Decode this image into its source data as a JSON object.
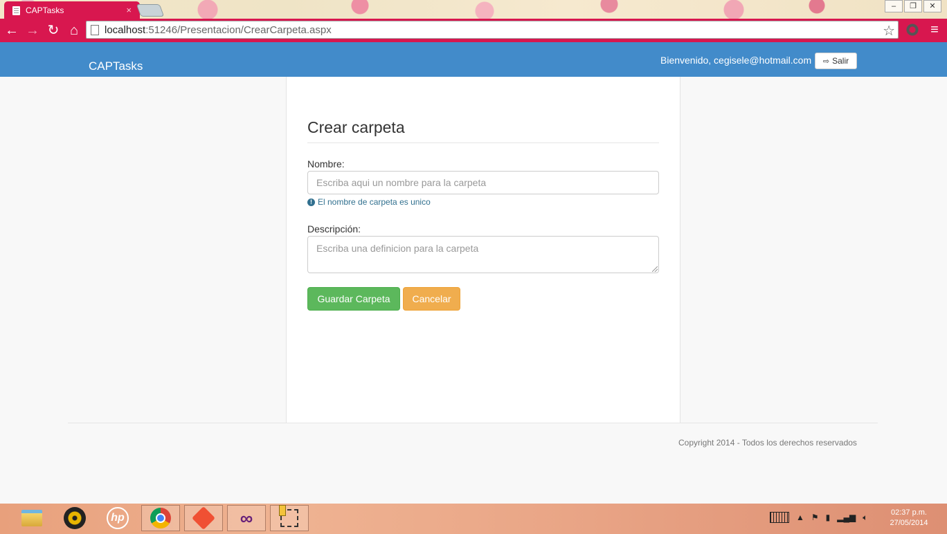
{
  "browser": {
    "tab_title": "CAPTasks",
    "tab_close": "×",
    "url_host": "localhost",
    "url_path": ":51246/Presentacion/CrearCarpeta.aspx",
    "icons": [
      "back-icon",
      "forward-icon",
      "reload-icon",
      "home-icon",
      "bookmark-star-icon",
      "menu-icon"
    ]
  },
  "navbar": {
    "brand": "CAPTasks",
    "welcome": "Bienvenido, cegisele@hotmail.com",
    "logout_label": "Salir"
  },
  "form": {
    "title": "Crear carpeta",
    "name_label": "Nombre:",
    "name_placeholder": "Escriba aqui un nombre para la carpeta",
    "name_value": "",
    "name_hint": "El nombre de carpeta es unico",
    "description_label": "Descripción:",
    "description_placeholder": "Escriba una definicion para la carpeta",
    "description_value": "",
    "save_label": "Guardar Carpeta",
    "cancel_label": "Cancelar"
  },
  "footer": {
    "copyright": "Copyright 2014 - Todos los derechos reservados"
  },
  "taskbar": {
    "clock_time": "02:37 p.m.",
    "clock_date": "27/05/2014"
  },
  "colors": {
    "browser_accent": "#d8174f",
    "navbar": "#428bca",
    "success": "#5cb85c",
    "warning": "#f0ad4e",
    "hint": "#31708f"
  }
}
